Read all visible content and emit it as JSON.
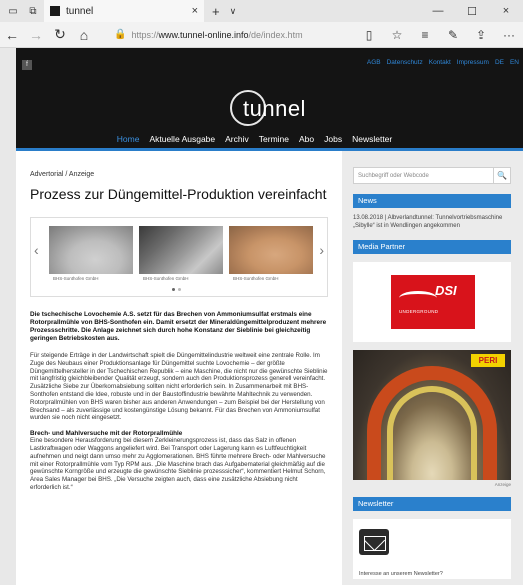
{
  "browser": {
    "tab_title": "tunnel",
    "tab_close": "×",
    "new_tab": "+",
    "tab_list": "∨",
    "win_min": "—",
    "win_max": "☐",
    "win_close": "×",
    "back": "←",
    "forward": "→",
    "refresh": "↻",
    "home": "⌂",
    "url_prefix": "https://",
    "url_domain": "www.tunnel-online.info",
    "url_path": "/de/index.htm",
    "reading_view": "▯",
    "favorite": "☆",
    "hub": "≡",
    "notes": "✎",
    "share": "⇪",
    "more": "···",
    "icons": [
      "tab-preview-icon",
      "set-aside-tabs-icon",
      "lock-icon"
    ]
  },
  "site": {
    "facebook_icon": "f",
    "top_links": [
      "AGB",
      "Datenschutz",
      "Kontakt",
      "Impressum",
      "DE",
      "EN"
    ],
    "logo": "tunnel",
    "nav": [
      "Home",
      "Aktuelle Ausgabe",
      "Archiv",
      "Termine",
      "Abo",
      "Jobs",
      "Newsletter"
    ],
    "nav_active": "Home",
    "accent": "#2a80cc"
  },
  "article": {
    "kicker": "Advertorial / Anzeige",
    "title": "Prozess zur Düngemittel-Produktion vereinfacht",
    "gallery": {
      "prev": "‹",
      "next": "›",
      "captions": [
        "BHS-Sonthofen GmbH",
        "BHS-Sonthofen GmbH",
        "BHS-Sonthofen GmbH"
      ]
    },
    "lead": "Die tschechische Lovochemie A.S. setzt für das Brechen von Ammoniumsulfat erstmals eine Rotorprallmühle von BHS-Sonthofen ein. Damit ersetzt der Mineraldüngemittelproduzent mehrere Prozessschritte. Die Anlage zeichnet sich durch hohe Konstanz der Sieblinie bei gleichzeitig geringen Betriebskosten aus.",
    "body": "Für steigende Erträge in der Landwirtschaft spielt die Düngemittelindustrie weltweit eine zentrale Rolle. Im Zuge des Neubaus einer Produktionsanlage für Düngemittel suchte Lovochemie – der größte Düngemittelhersteller in der Tschechischen Republik – eine Maschine, die nicht nur die gewünschte Sieblinie mit langfristig gleichbleibender Qualität erzeugt, sondern auch den Produktionsprozess generell vereinfacht. Zusätzliche Siebe zur Überkornabsiebung sollten nicht erforderlich sein. In Zusammenarbeit mit BHS-Sonthofen entstand die Idee, robuste und in der Baustoffindustrie bewährte Mahltechnik zu verwenden. Rotorprallmühlen von BHS waren bisher aus anderen Anwendungen – zum Beispiel bei der Herstellung von Brechsand – als zuverlässige und kostengünstige Lösung bekannt. Für das Brechen von Ammoniumsulfat wurden sie noch nicht eingesetzt.",
    "subhead": "Brech- und Mahlversuche mit der Rotorprallmühle",
    "body2": "Eine besondere Herausforderung bei diesem Zerkleinerungsprozess ist, dass das Salz in offenen Lastkraftwagen oder Waggons angeliefert wird. Bei Transport oder Lagerung kann es Luftfeuchtigkeit aufnehmen und neigt dann umso mehr zu Agglomerationen. BHS führte mehrere Brech- oder Mahlversuche mit einer Rotorprallmühle vom Typ RPM aus. „Die Maschine brach das Aufgabematerial gleichmäßig auf die gewünschte Korngröße und erzeugte die gewünschte Sieblinie prozesssicher“, kommentiert Helmut Schorn, Area Sales Manager bei BHS. „Die Versuche zeigten auch, dass eine zusätzliche Absiebung nicht erforderlich ist.“"
  },
  "sidebar": {
    "search_placeholder": "Suchbegriff oder Webcode",
    "search_button": "🔍",
    "news_title": "News",
    "news_item": "13.08.2018 | Albverlandtunnel: Tunnelvortriebsmaschine „Sibylle“ ist in Wendlingen angekommen",
    "media_title": "Media Partner",
    "dsi_logo": "DSI",
    "dsi_sub": "UNDERGROUND",
    "peri_logo": "PERI",
    "ad_label": "Anzeige",
    "newsletter_title": "Newsletter",
    "newsletter_text": "Interesse an unserem Newsletter?"
  }
}
